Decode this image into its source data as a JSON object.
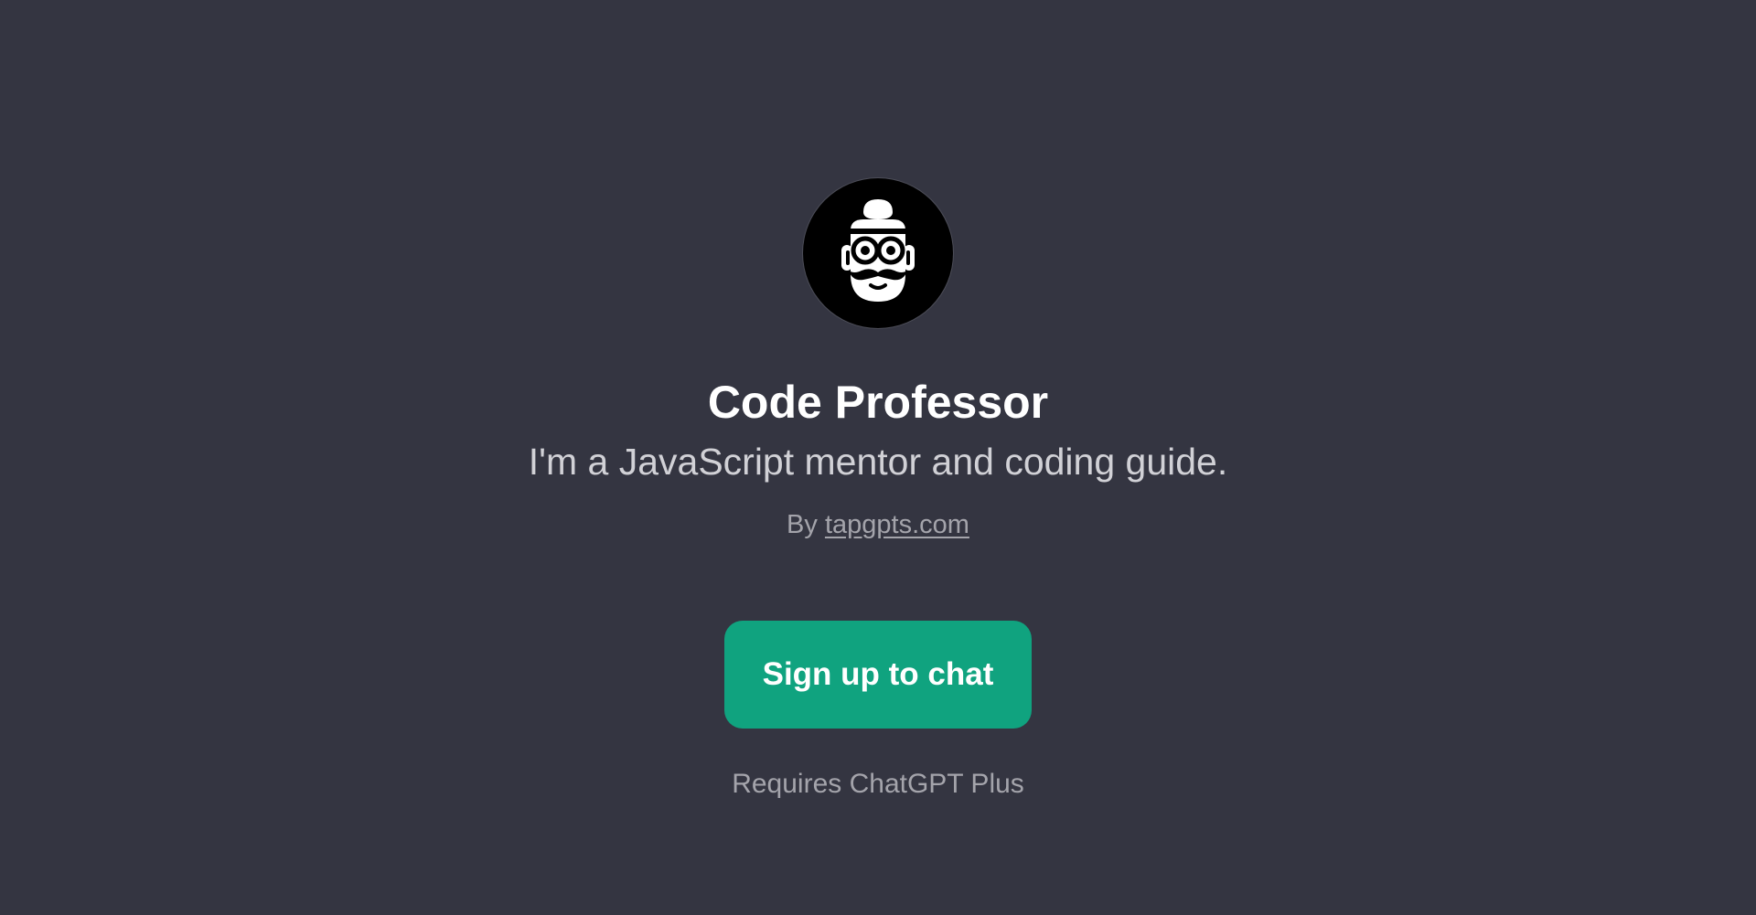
{
  "gpt": {
    "avatar_icon": "professor-face-icon",
    "name": "Code Professor",
    "description": "I'm a JavaScript mentor and coding guide.",
    "byline_prefix": "By",
    "author": "tapgpts.com"
  },
  "actions": {
    "signup_label": "Sign up to chat",
    "requirement": "Requires ChatGPT Plus"
  },
  "colors": {
    "background": "#343541",
    "accent": "#10a37f",
    "avatar_bg": "#000000"
  }
}
